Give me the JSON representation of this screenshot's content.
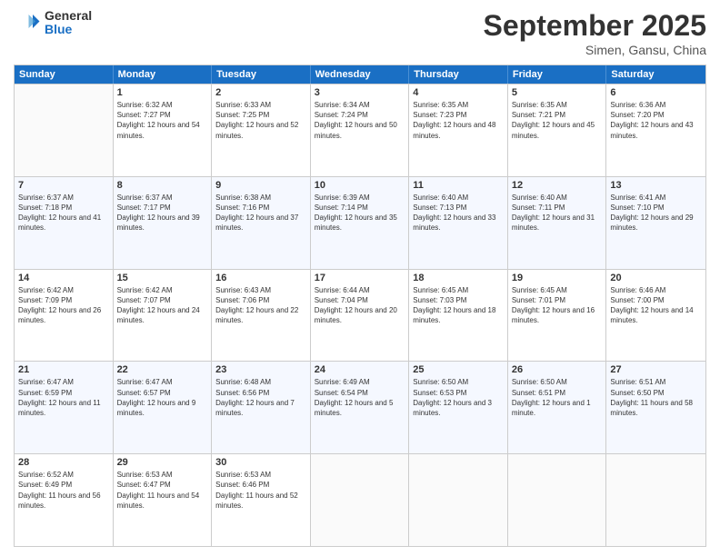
{
  "header": {
    "logo_general": "General",
    "logo_blue": "Blue",
    "month_title": "September 2025",
    "location": "Simen, Gansu, China"
  },
  "days_of_week": [
    "Sunday",
    "Monday",
    "Tuesday",
    "Wednesday",
    "Thursday",
    "Friday",
    "Saturday"
  ],
  "weeks": [
    [
      {
        "day": "",
        "sunrise": "",
        "sunset": "",
        "daylight": ""
      },
      {
        "day": "1",
        "sunrise": "Sunrise: 6:32 AM",
        "sunset": "Sunset: 7:27 PM",
        "daylight": "Daylight: 12 hours and 54 minutes."
      },
      {
        "day": "2",
        "sunrise": "Sunrise: 6:33 AM",
        "sunset": "Sunset: 7:25 PM",
        "daylight": "Daylight: 12 hours and 52 minutes."
      },
      {
        "day": "3",
        "sunrise": "Sunrise: 6:34 AM",
        "sunset": "Sunset: 7:24 PM",
        "daylight": "Daylight: 12 hours and 50 minutes."
      },
      {
        "day": "4",
        "sunrise": "Sunrise: 6:35 AM",
        "sunset": "Sunset: 7:23 PM",
        "daylight": "Daylight: 12 hours and 48 minutes."
      },
      {
        "day": "5",
        "sunrise": "Sunrise: 6:35 AM",
        "sunset": "Sunset: 7:21 PM",
        "daylight": "Daylight: 12 hours and 45 minutes."
      },
      {
        "day": "6",
        "sunrise": "Sunrise: 6:36 AM",
        "sunset": "Sunset: 7:20 PM",
        "daylight": "Daylight: 12 hours and 43 minutes."
      }
    ],
    [
      {
        "day": "7",
        "sunrise": "Sunrise: 6:37 AM",
        "sunset": "Sunset: 7:18 PM",
        "daylight": "Daylight: 12 hours and 41 minutes."
      },
      {
        "day": "8",
        "sunrise": "Sunrise: 6:37 AM",
        "sunset": "Sunset: 7:17 PM",
        "daylight": "Daylight: 12 hours and 39 minutes."
      },
      {
        "day": "9",
        "sunrise": "Sunrise: 6:38 AM",
        "sunset": "Sunset: 7:16 PM",
        "daylight": "Daylight: 12 hours and 37 minutes."
      },
      {
        "day": "10",
        "sunrise": "Sunrise: 6:39 AM",
        "sunset": "Sunset: 7:14 PM",
        "daylight": "Daylight: 12 hours and 35 minutes."
      },
      {
        "day": "11",
        "sunrise": "Sunrise: 6:40 AM",
        "sunset": "Sunset: 7:13 PM",
        "daylight": "Daylight: 12 hours and 33 minutes."
      },
      {
        "day": "12",
        "sunrise": "Sunrise: 6:40 AM",
        "sunset": "Sunset: 7:11 PM",
        "daylight": "Daylight: 12 hours and 31 minutes."
      },
      {
        "day": "13",
        "sunrise": "Sunrise: 6:41 AM",
        "sunset": "Sunset: 7:10 PM",
        "daylight": "Daylight: 12 hours and 29 minutes."
      }
    ],
    [
      {
        "day": "14",
        "sunrise": "Sunrise: 6:42 AM",
        "sunset": "Sunset: 7:09 PM",
        "daylight": "Daylight: 12 hours and 26 minutes."
      },
      {
        "day": "15",
        "sunrise": "Sunrise: 6:42 AM",
        "sunset": "Sunset: 7:07 PM",
        "daylight": "Daylight: 12 hours and 24 minutes."
      },
      {
        "day": "16",
        "sunrise": "Sunrise: 6:43 AM",
        "sunset": "Sunset: 7:06 PM",
        "daylight": "Daylight: 12 hours and 22 minutes."
      },
      {
        "day": "17",
        "sunrise": "Sunrise: 6:44 AM",
        "sunset": "Sunset: 7:04 PM",
        "daylight": "Daylight: 12 hours and 20 minutes."
      },
      {
        "day": "18",
        "sunrise": "Sunrise: 6:45 AM",
        "sunset": "Sunset: 7:03 PM",
        "daylight": "Daylight: 12 hours and 18 minutes."
      },
      {
        "day": "19",
        "sunrise": "Sunrise: 6:45 AM",
        "sunset": "Sunset: 7:01 PM",
        "daylight": "Daylight: 12 hours and 16 minutes."
      },
      {
        "day": "20",
        "sunrise": "Sunrise: 6:46 AM",
        "sunset": "Sunset: 7:00 PM",
        "daylight": "Daylight: 12 hours and 14 minutes."
      }
    ],
    [
      {
        "day": "21",
        "sunrise": "Sunrise: 6:47 AM",
        "sunset": "Sunset: 6:59 PM",
        "daylight": "Daylight: 12 hours and 11 minutes."
      },
      {
        "day": "22",
        "sunrise": "Sunrise: 6:47 AM",
        "sunset": "Sunset: 6:57 PM",
        "daylight": "Daylight: 12 hours and 9 minutes."
      },
      {
        "day": "23",
        "sunrise": "Sunrise: 6:48 AM",
        "sunset": "Sunset: 6:56 PM",
        "daylight": "Daylight: 12 hours and 7 minutes."
      },
      {
        "day": "24",
        "sunrise": "Sunrise: 6:49 AM",
        "sunset": "Sunset: 6:54 PM",
        "daylight": "Daylight: 12 hours and 5 minutes."
      },
      {
        "day": "25",
        "sunrise": "Sunrise: 6:50 AM",
        "sunset": "Sunset: 6:53 PM",
        "daylight": "Daylight: 12 hours and 3 minutes."
      },
      {
        "day": "26",
        "sunrise": "Sunrise: 6:50 AM",
        "sunset": "Sunset: 6:51 PM",
        "daylight": "Daylight: 12 hours and 1 minute."
      },
      {
        "day": "27",
        "sunrise": "Sunrise: 6:51 AM",
        "sunset": "Sunset: 6:50 PM",
        "daylight": "Daylight: 11 hours and 58 minutes."
      }
    ],
    [
      {
        "day": "28",
        "sunrise": "Sunrise: 6:52 AM",
        "sunset": "Sunset: 6:49 PM",
        "daylight": "Daylight: 11 hours and 56 minutes."
      },
      {
        "day": "29",
        "sunrise": "Sunrise: 6:53 AM",
        "sunset": "Sunset: 6:47 PM",
        "daylight": "Daylight: 11 hours and 54 minutes."
      },
      {
        "day": "30",
        "sunrise": "Sunrise: 6:53 AM",
        "sunset": "Sunset: 6:46 PM",
        "daylight": "Daylight: 11 hours and 52 minutes."
      },
      {
        "day": "",
        "sunrise": "",
        "sunset": "",
        "daylight": ""
      },
      {
        "day": "",
        "sunrise": "",
        "sunset": "",
        "daylight": ""
      },
      {
        "day": "",
        "sunrise": "",
        "sunset": "",
        "daylight": ""
      },
      {
        "day": "",
        "sunrise": "",
        "sunset": "",
        "daylight": ""
      }
    ]
  ]
}
